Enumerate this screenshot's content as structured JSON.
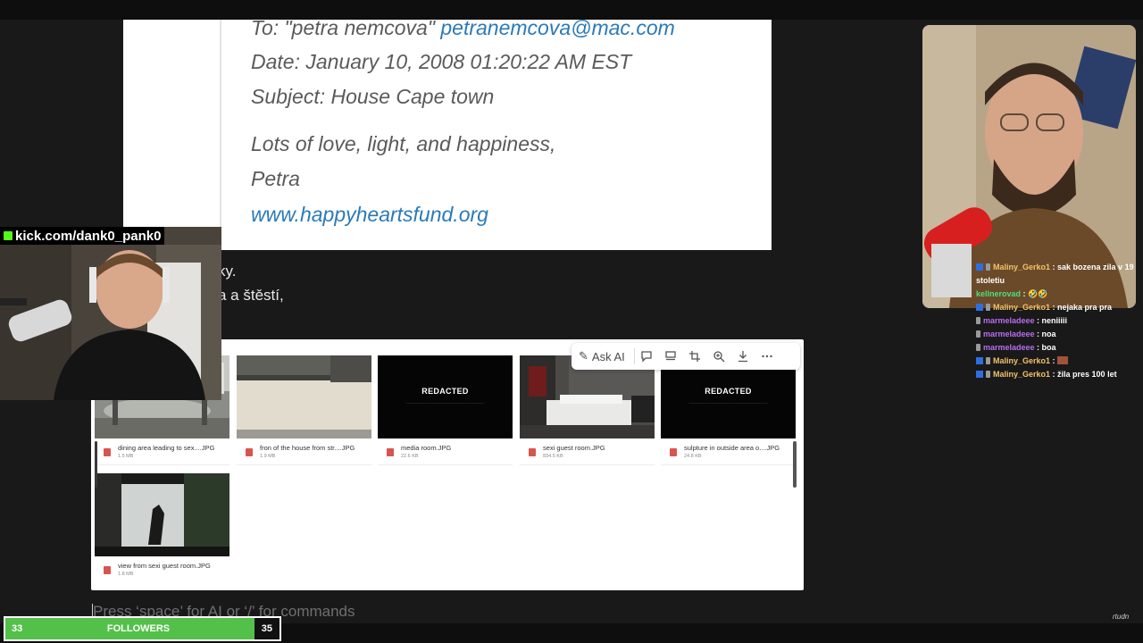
{
  "email": {
    "to_label": "To: \"petra nemcova\"",
    "to_email": "petranemcova@mac.com",
    "date": "Date: January 10, 2008 01:20:22 AM EST",
    "subject": "Subject: House Cape town",
    "closing": "Lots of love, light, and happiness,",
    "signature": "Petra",
    "url": "www.happyheartsfund.org"
  },
  "doc": {
    "line1": "ky.",
    "line2": "a a štěstí,"
  },
  "toolbar": {
    "ask_ai": "Ask AI"
  },
  "files": [
    {
      "name": "dining area leading to sex....JPG",
      "size": "1.5 MB",
      "redacted": false
    },
    {
      "name": "fron of the house from str....JPG",
      "size": "1.9 MB",
      "redacted": false
    },
    {
      "name": "media room.JPG",
      "size": "22.6 KB",
      "redacted": true,
      "redacted_label": "REDACTED"
    },
    {
      "name": "sexi guest room.JPG",
      "size": "834.5 KB",
      "redacted": false
    },
    {
      "name": "sulpture in outside area o....JPG",
      "size": "24.8 KB",
      "redacted": true,
      "redacted_label": "REDACTED"
    },
    {
      "name": "view from sexi guest room.JPG",
      "size": "1.8 MB",
      "redacted": false
    }
  ],
  "command_placeholder": "Press ‘space’ for AI or ‘/’ for commands",
  "stream": {
    "kick_channel": "kick.com/dank0_pank0",
    "followers_label": "FOLLOWERS",
    "followers_current": "33",
    "followers_goal": "35",
    "watermark": "rtudn"
  },
  "chat": [
    {
      "user": "Maliny_Gerko1",
      "color_class": "u-gerko",
      "badge": true,
      "message": "sak bozena zila v 19 stoletiu"
    },
    {
      "user": "kellnerovad",
      "color_class": "u-kell",
      "badge": false,
      "message": "🤣🤣"
    },
    {
      "user": "Maliny_Gerko1",
      "color_class": "u-gerko",
      "badge": true,
      "message": "nejaka pra pra"
    },
    {
      "user": "marmeladeee",
      "color_class": "u-marm",
      "badge": false,
      "message": "neniiiii"
    },
    {
      "user": "marmeladeee",
      "color_class": "u-marm",
      "badge": false,
      "message": "noa"
    },
    {
      "user": "marmeladeee",
      "color_class": "u-marm",
      "badge": false,
      "message": "boa"
    },
    {
      "user": "Maliny_Gerko1",
      "color_class": "u-gerko",
      "badge": true,
      "message": ""
    },
    {
      "user": "Maliny_Gerko1",
      "color_class": "u-gerko",
      "badge": true,
      "message": "žila pres 100 let"
    }
  ]
}
